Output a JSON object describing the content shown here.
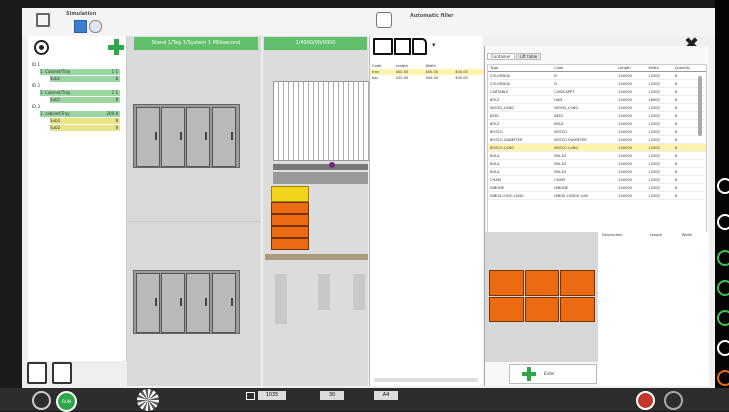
{
  "window": {
    "left_tab_label": "Simulation",
    "right_tab_label": "Automatic filler"
  },
  "left_tree": {
    "items": [
      {
        "label": "ID 1",
        "value": ""
      },
      {
        "label": "1. Cabinet/Tray",
        "value": "1  1"
      },
      {
        "label": "Sub1",
        "value": "8"
      },
      {
        "label": "ID 2",
        "value": ""
      },
      {
        "label": "1. Cabinet/Tray",
        "value": "1  1"
      },
      {
        "label": "Sub1",
        "value": "8"
      },
      {
        "label": "ID 3",
        "value": ""
      },
      {
        "label": "1. cabinet/Tray",
        "value": "200  8"
      },
      {
        "label": "Sub1",
        "value": "8"
      },
      {
        "label": "Sub2",
        "value": "8"
      }
    ]
  },
  "center": {
    "header_left": "Stand 1/Tag 1/System 1 Millisecond",
    "header_right": "1/4000/00/0000"
  },
  "list_table": {
    "headers": [
      "Code",
      "Length",
      "Width",
      ""
    ],
    "rows": [
      [
        "tray",
        "400.00",
        "400.00",
        "400.00"
      ],
      [
        "bsc",
        "200.00",
        "400.00",
        "400.00"
      ]
    ]
  },
  "right_panel": {
    "tabs": [
      "Container",
      "Lift table"
    ],
    "headers": [
      "Type",
      "Code",
      "Length",
      "Width",
      "Quantity"
    ],
    "rows": [
      [
        "COLORBOX",
        "B",
        "240000",
        "12000",
        "6"
      ],
      [
        "COLORBOX",
        "D",
        "240000",
        "12000",
        "6"
      ],
      [
        "CARTABLE",
        "CUBICAPPT",
        "240000",
        "12000",
        "6"
      ],
      [
        "BOLE",
        "HAN",
        "240000",
        "16000",
        "6"
      ],
      [
        "WOOD_LONG",
        "WOOD_LONG",
        "240000",
        "12000",
        "6"
      ],
      [
        "BEDI",
        "BEDI",
        "240000",
        "12000",
        "6"
      ],
      [
        "BOLE",
        "BOLE",
        "240000",
        "12000",
        "6"
      ],
      [
        "BOSCO",
        "BOSCO",
        "240000",
        "12000",
        "6"
      ],
      [
        "BOSCO DIAMETER",
        "BOSCO DIAMETER",
        "240000",
        "12000",
        "6"
      ],
      [
        "BOSCO LUNG",
        "BOSCO LUNG",
        "240000",
        "12000",
        "6"
      ],
      [
        "BULA",
        "BULA2",
        "240000",
        "12000",
        "6"
      ],
      [
        "BULA",
        "BULA2",
        "240000",
        "12000",
        "6"
      ],
      [
        "BULA",
        "BULA3",
        "240000",
        "12000",
        "6"
      ],
      [
        "CHAM",
        "CHAM",
        "240000",
        "12000",
        "6"
      ],
      [
        "DIBONE",
        "DIBONE",
        "240000",
        "12000",
        "6"
      ],
      [
        "DIBOX LONG LUNG",
        "DIBOX LONGH LUN",
        "240000",
        "12000",
        "6"
      ]
    ],
    "lower_headers": [
      "Description",
      "Length",
      "Width"
    ],
    "add_button_label": "Enter"
  },
  "bottom_bar": {
    "start_label": "RUN",
    "field_1": "1035",
    "field_2": "30",
    "field_3": "A4"
  },
  "colors": {
    "accent_green": "#5fbf6a",
    "orange": "#ec6a12",
    "highlight_yellow": "#fff3b0"
  }
}
